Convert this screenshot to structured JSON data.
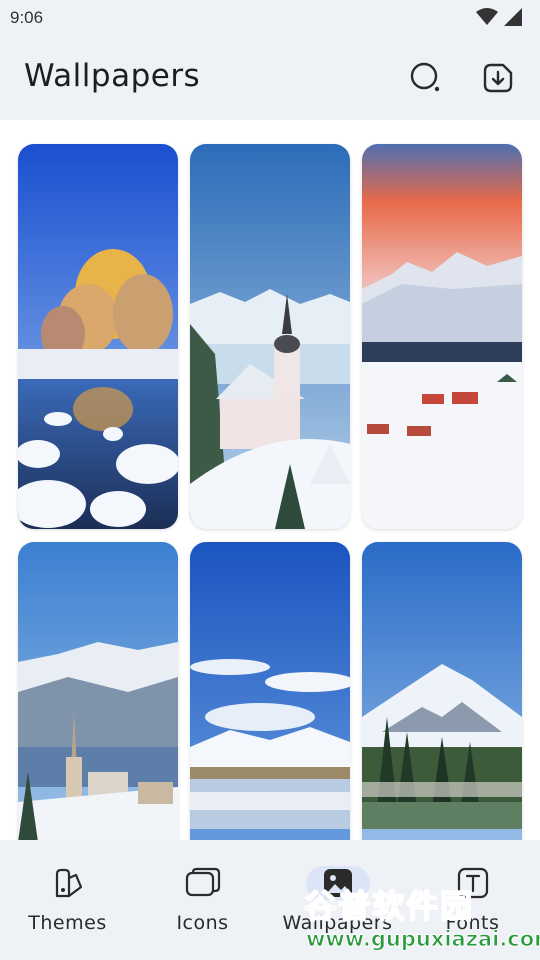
{
  "status_bar": {
    "time": "9:06",
    "icons": [
      "wifi-icon",
      "signal-icon"
    ]
  },
  "header": {
    "title": "Wallpapers",
    "search_icon": "search-icon",
    "download_icon": "download-icon"
  },
  "wallpapers": [
    {
      "subject": "snowy lake with golden trees"
    },
    {
      "subject": "church on snowy hill"
    },
    {
      "subject": "snowy alpine village at sunset"
    },
    {
      "subject": "lakeside village with church spire"
    },
    {
      "subject": "snowy mountains and clouds over lake"
    },
    {
      "subject": "volcano with pine forest"
    }
  ],
  "bottom_nav": {
    "items": [
      {
        "label": "Themes",
        "icon": "brush-palette-icon"
      },
      {
        "label": "Icons",
        "icon": "stacked-squares-icon"
      },
      {
        "label": "Wallpapers",
        "icon": "image-icon",
        "active": true
      },
      {
        "label": "Fonts",
        "icon": "text-box-icon"
      }
    ]
  },
  "watermark": {
    "text_cn": "谷普软件园",
    "url": "www.gupuxiazai.com"
  },
  "colors": {
    "header_bg": "#eef1f6",
    "active_pill": "#dbe5f7",
    "watermark_green": "#2a9a3a"
  }
}
